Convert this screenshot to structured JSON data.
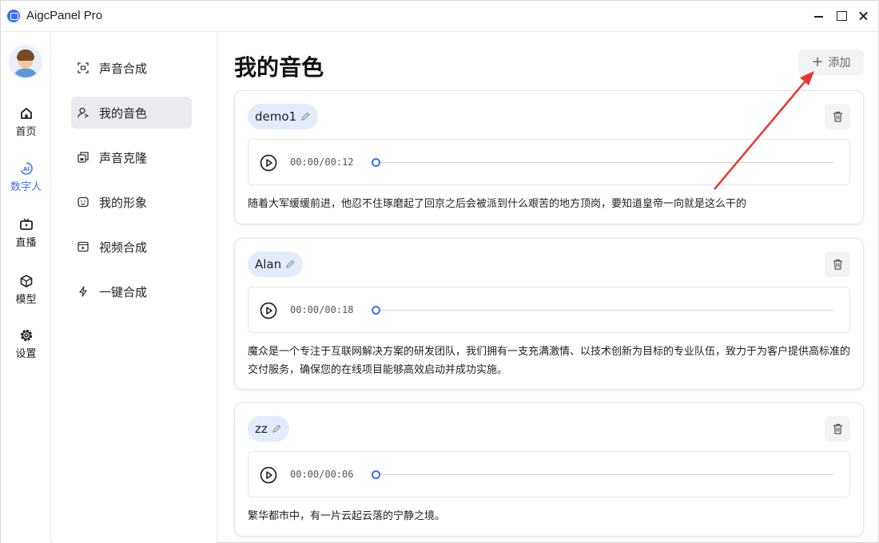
{
  "app": {
    "title": "AigcPanel Pro"
  },
  "rail": {
    "items": [
      {
        "label": "首页",
        "icon": "home-icon"
      },
      {
        "label": "数字人",
        "icon": "ai-icon",
        "active": true
      },
      {
        "label": "直播",
        "icon": "tv-icon"
      },
      {
        "label": "模型",
        "icon": "cube-icon"
      },
      {
        "label": "设置",
        "icon": "gear-icon"
      }
    ]
  },
  "subnav": {
    "items": [
      {
        "label": "声音合成",
        "icon": "scan-icon"
      },
      {
        "label": "我的音色",
        "icon": "user-voice-icon",
        "active": true
      },
      {
        "label": "声音克隆",
        "icon": "clone-icon"
      },
      {
        "label": "我的形象",
        "icon": "face-icon"
      },
      {
        "label": "视频合成",
        "icon": "video-icon"
      },
      {
        "label": "一键合成",
        "icon": "bolt-icon"
      }
    ]
  },
  "main": {
    "title": "我的音色",
    "add_label": "添加",
    "voices": [
      {
        "name": "demo1",
        "time": "00:00/00:12",
        "progress": 0,
        "text": "随着大军缓缓前进，他忍不住琢磨起了回京之后会被派到什么艰苦的地方顶岗，要知道皇帝一向就是这么干的"
      },
      {
        "name": "Alan",
        "time": "00:00/00:18",
        "progress": 0,
        "text": "魔众是一个专注于互联网解决方案的研发团队，我们拥有一支充满激情、以技术创新为目标的专业队伍，致力于为客户提供高标准的交付服务，确保您的在线项目能够高效启动并成功实施。"
      },
      {
        "name": "zz",
        "time": "00:00/00:06",
        "progress": 0,
        "text": "繁华都市中，有一片云起云落的宁静之境。"
      }
    ]
  },
  "colors": {
    "accent": "#3b6ff5",
    "annotation_arrow": "#e8352b"
  }
}
